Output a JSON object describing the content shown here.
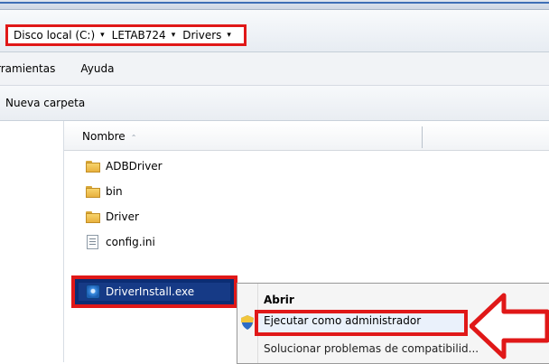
{
  "address": {
    "crumbs": [
      "Disco local (C:)",
      "LETAB724",
      "Drivers"
    ],
    "arrow": "▾"
  },
  "menu": {
    "items": [
      "rramientas",
      "Ayuda"
    ]
  },
  "toolbar": {
    "new_folder": "Nueva carpeta"
  },
  "columns": {
    "name": "Nombre",
    "sort_indicator": "⌃"
  },
  "files": [
    {
      "name": "ADBDriver",
      "icon": "folder-icon"
    },
    {
      "name": "bin",
      "icon": "folder-icon"
    },
    {
      "name": "Driver",
      "icon": "folder-icon"
    },
    {
      "name": "config.ini",
      "icon": "ini-file-icon"
    }
  ],
  "selected_file": {
    "name": "DriverInstall.exe",
    "icon": "exe-icon"
  },
  "context_menu": {
    "open": "Abrir",
    "run_as_admin": "Ejecutar como administrador",
    "compat": "Solucionar problemas de compatibilid..."
  },
  "colors": {
    "highlight_red": "#e01818",
    "selection_blue": "#163a86"
  }
}
